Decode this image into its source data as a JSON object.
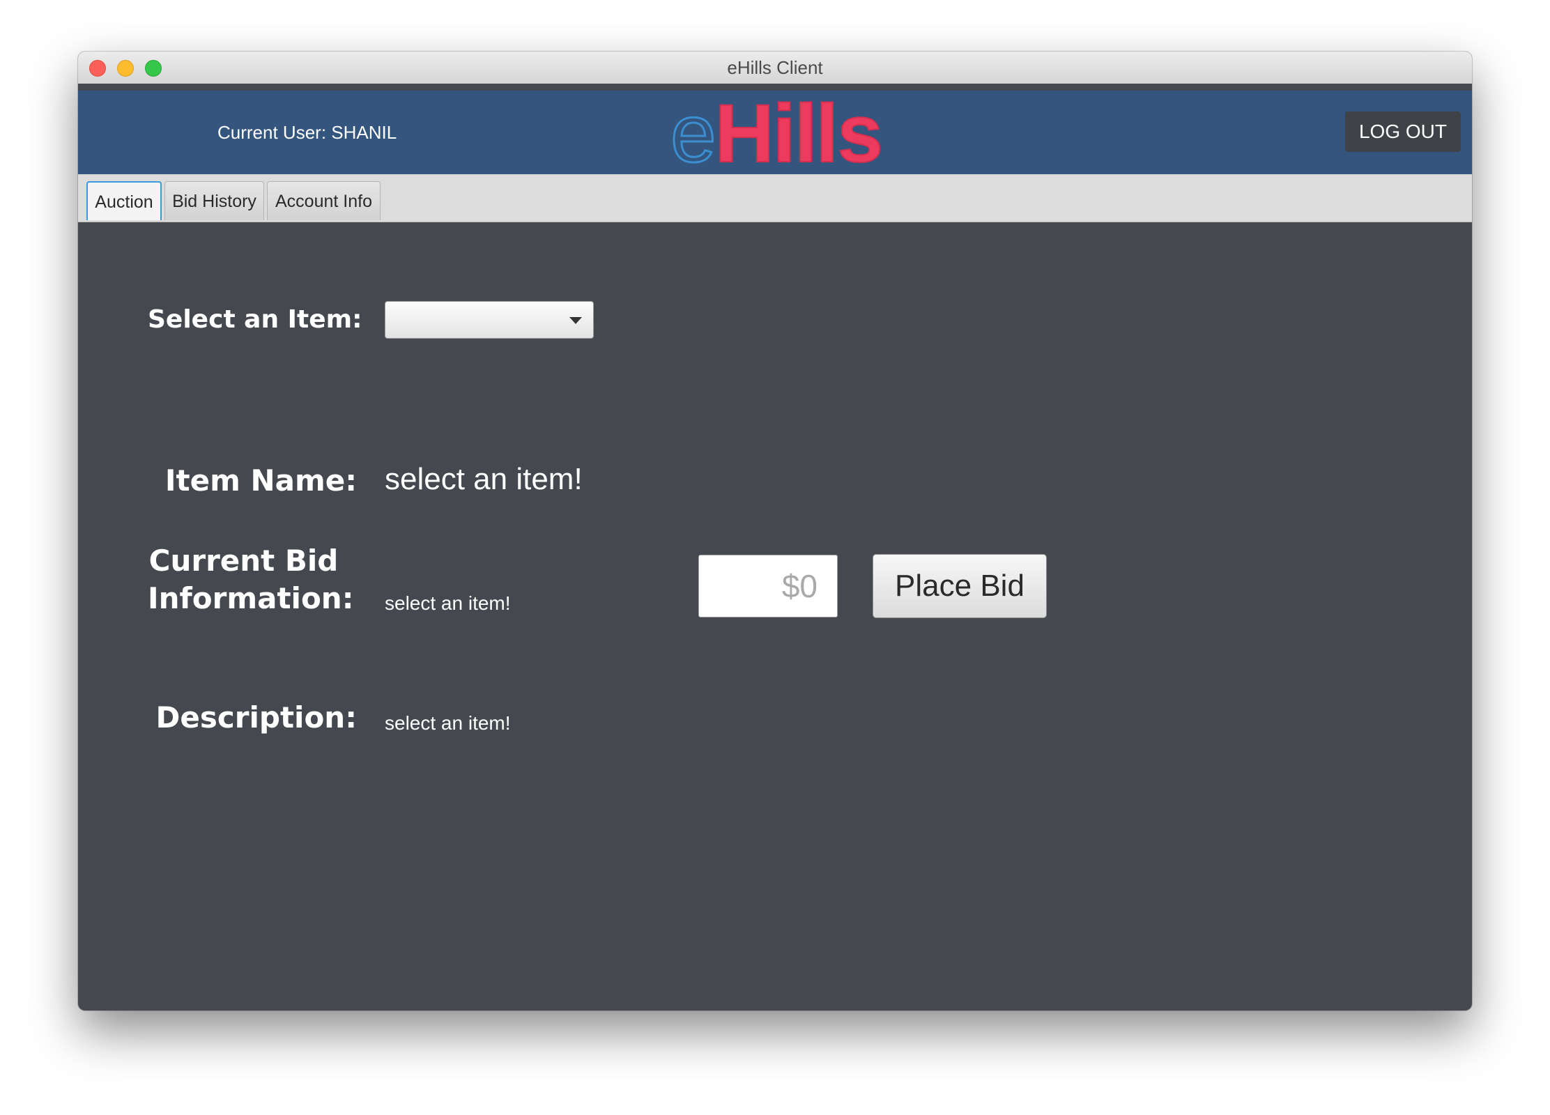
{
  "window": {
    "title": "eHills Client"
  },
  "header": {
    "current_user_label": "Current User: SHANIL",
    "logo_e": "e",
    "logo_rest": "Hills",
    "logout_label": "LOG OUT"
  },
  "tabs": [
    {
      "label": "Auction",
      "active": true
    },
    {
      "label": "Bid History",
      "active": false
    },
    {
      "label": "Account Info",
      "active": false
    }
  ],
  "auction": {
    "select_item_label": "Select an Item:",
    "select_item_value": "",
    "item_name_label": "Item Name:",
    "item_name_value": "select an item!",
    "current_bid_label_line1": "Current Bid",
    "current_bid_label_line2": "Information:",
    "current_bid_value": "select an item!",
    "bid_input_placeholder": "$0",
    "place_bid_label": "Place Bid",
    "description_label": "Description:",
    "description_value": "select an item!"
  },
  "colors": {
    "header_bg": "#34557e",
    "content_bg": "#45484e",
    "logo_red": "#ec3b5c",
    "logo_blue": "#3b8fd0",
    "active_tab_border": "#3a9ad9"
  }
}
